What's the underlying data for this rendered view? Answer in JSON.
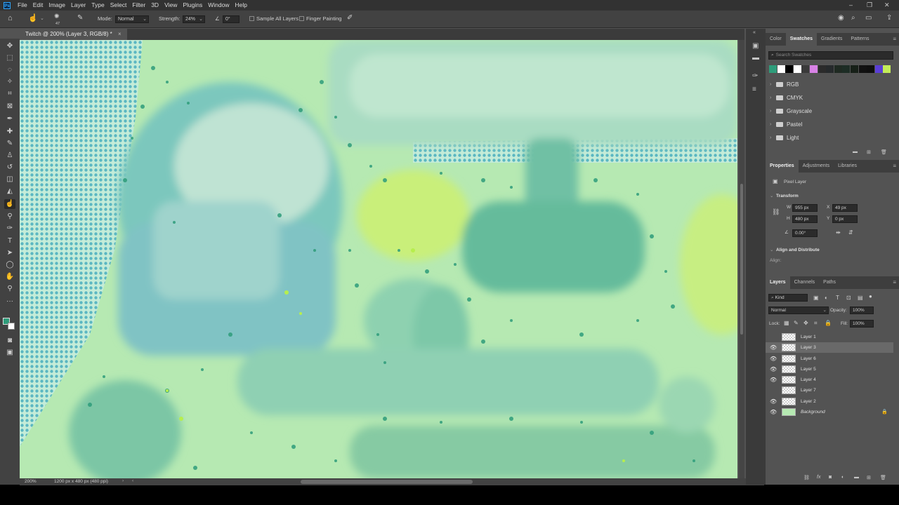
{
  "menu": [
    "File",
    "Edit",
    "Image",
    "Layer",
    "Type",
    "Select",
    "Filter",
    "3D",
    "View",
    "Plugins",
    "Window",
    "Help"
  ],
  "options": {
    "brush_size": "47",
    "mode_label": "Mode:",
    "mode_value": "Normal",
    "strength_label": "Strength:",
    "strength_value": "24%",
    "angle_value": "0°",
    "sample_all_layers": "Sample All Layers",
    "finger_painting": "Finger Painting"
  },
  "document": {
    "tab_title": "Twitch @ 200% (Layer 3, RGB/8) *",
    "zoom": "200%",
    "doc_size": "1200 px x 480 px (480 ppi)"
  },
  "swatches_panel": {
    "tabs": [
      "Color",
      "Swatches",
      "Gradients",
      "Patterns"
    ],
    "active_tab": "Swatches",
    "search_placeholder": "Search Swatches",
    "colors": [
      "#2e9c7a",
      "#ffffff",
      "#000000",
      "#ffffff",
      "#3a3a3a",
      "#d882e6",
      "#2b2b2b",
      "#262a2c",
      "#1f2a22",
      "#1d2d25",
      "#172018",
      "#111111",
      "#0f0f0f",
      "#5b3fd6",
      "#c3ec58"
    ],
    "folders": [
      "RGB",
      "CMYK",
      "Grayscale",
      "Pastel",
      "Light"
    ]
  },
  "properties_panel": {
    "tabs": [
      "Properties",
      "Adjustments",
      "Libraries"
    ],
    "active_tab": "Properties",
    "kind": "Pixel Layer",
    "transform_label": "Transform",
    "w_label": "W",
    "w_value": "955 px",
    "h_label": "H",
    "h_value": "480 px",
    "x_label": "X",
    "x_value": "49 px",
    "y_label": "Y",
    "y_value": "0 px",
    "angle_value": "0.00°",
    "align_label": "Align and Distribute",
    "align_sub": "Align:"
  },
  "layers_panel": {
    "tabs": [
      "Layers",
      "Channels",
      "Paths"
    ],
    "active_tab": "Layers",
    "filter_kind": "Kind",
    "blend_mode": "Normal",
    "opacity_label": "Opacity:",
    "opacity_value": "100%",
    "lock_label": "Lock:",
    "fill_label": "Fill:",
    "fill_value": "100%",
    "layers": [
      {
        "name": "Layer 1",
        "visible": false,
        "selected": false
      },
      {
        "name": "Layer 3",
        "visible": true,
        "selected": true
      },
      {
        "name": "Layer 6",
        "visible": true,
        "selected": false
      },
      {
        "name": "Layer 5",
        "visible": true,
        "selected": false
      },
      {
        "name": "Layer 4",
        "visible": true,
        "selected": false
      },
      {
        "name": "Layer 7",
        "visible": false,
        "selected": false
      },
      {
        "name": "Layer 2",
        "visible": true,
        "selected": false
      },
      {
        "name": "Background",
        "visible": true,
        "selected": false
      }
    ]
  }
}
